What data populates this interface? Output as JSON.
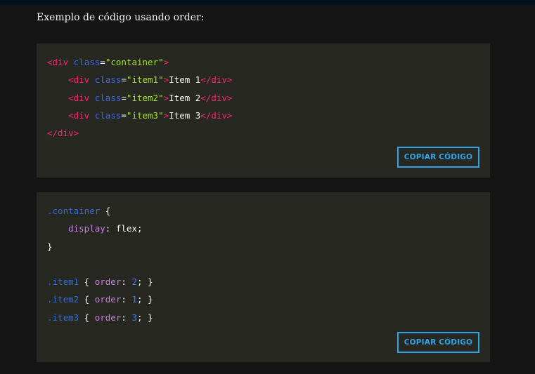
{
  "intro": "Exemplo de código usando order:",
  "blocks": [
    {
      "copy_label": "COPIAR CÓDIGO",
      "lines": [
        [
          [
            "tag",
            "<div "
          ],
          [
            "attr",
            "class"
          ],
          [
            "punct",
            "="
          ],
          [
            "str",
            "\"container\""
          ],
          [
            "tag",
            ">"
          ]
        ],
        [
          [
            "text",
            "    "
          ],
          [
            "tag",
            "<div "
          ],
          [
            "attr",
            "class"
          ],
          [
            "punct",
            "="
          ],
          [
            "str",
            "\"item1\""
          ],
          [
            "tag",
            ">"
          ],
          [
            "text",
            "Item 1"
          ],
          [
            "tag",
            "</div>"
          ]
        ],
        [
          [
            "text",
            "    "
          ],
          [
            "tag",
            "<div "
          ],
          [
            "attr",
            "class"
          ],
          [
            "punct",
            "="
          ],
          [
            "str",
            "\"item2\""
          ],
          [
            "tag",
            ">"
          ],
          [
            "text",
            "Item 2"
          ],
          [
            "tag",
            "</div>"
          ]
        ],
        [
          [
            "text",
            "    "
          ],
          [
            "tag",
            "<div "
          ],
          [
            "attr",
            "class"
          ],
          [
            "punct",
            "="
          ],
          [
            "str",
            "\"item3\""
          ],
          [
            "tag",
            ">"
          ],
          [
            "text",
            "Item 3"
          ],
          [
            "tag",
            "</div>"
          ]
        ],
        [
          [
            "tag",
            "</div>"
          ]
        ]
      ]
    },
    {
      "copy_label": "COPIAR CÓDIGO",
      "lines": [
        [
          [
            "sel",
            ".container"
          ],
          [
            "punct",
            " {"
          ]
        ],
        [
          [
            "text",
            "    "
          ],
          [
            "prop",
            "display"
          ],
          [
            "punct",
            ": "
          ],
          [
            "text",
            "flex"
          ],
          [
            "punct",
            ";"
          ]
        ],
        [
          [
            "punct",
            "}"
          ]
        ],
        [
          [
            "text",
            ""
          ]
        ],
        [
          [
            "sel",
            ".item1"
          ],
          [
            "punct",
            " { "
          ],
          [
            "prop",
            "order"
          ],
          [
            "punct",
            ": "
          ],
          [
            "num",
            "2"
          ],
          [
            "punct",
            "; }"
          ]
        ],
        [
          [
            "sel",
            ".item2"
          ],
          [
            "punct",
            " { "
          ],
          [
            "prop",
            "order"
          ],
          [
            "punct",
            ": "
          ],
          [
            "num",
            "1"
          ],
          [
            "punct",
            "; }"
          ]
        ],
        [
          [
            "sel",
            ".item3"
          ],
          [
            "punct",
            " { "
          ],
          [
            "prop",
            "order"
          ],
          [
            "punct",
            ": "
          ],
          [
            "num",
            "3"
          ],
          [
            "punct",
            "; }"
          ]
        ]
      ]
    }
  ],
  "colors": {
    "page_bg": "#151515",
    "code_bg": "#272822",
    "tag": "#f92672",
    "attr": "#3b66e8",
    "string": "#a6e22e",
    "text": "#f8f8f2",
    "selector": "#2f6bd6",
    "property": "#c77dde",
    "number": "#3b7bf0",
    "button": "#2fa4e7"
  }
}
